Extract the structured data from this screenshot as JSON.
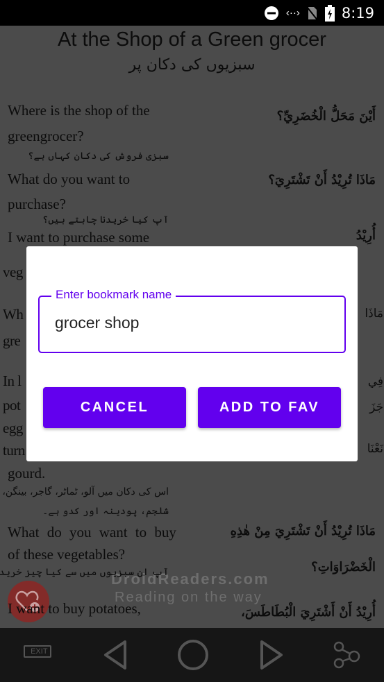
{
  "status_bar": {
    "time": "8:19",
    "icons": [
      "do-not-disturb-icon",
      "data-sync-icon",
      "no-sim-icon",
      "battery-charging-icon"
    ]
  },
  "page": {
    "title": "At the Shop of a Green grocer",
    "urdu_title": "سبزیوں کی دکان پر",
    "english_lines": [
      "Where is the shop of the",
      "greengrocer?",
      "What do you want to",
      "purchase?",
      "I want to purchase some",
      "veg",
      "Wh",
      "gre",
      "In l",
      "pot",
      "egg",
      "turn",
      "gourd.",
      "What do you want to buy",
      "of these vegetables?",
      "I want to buy potatoes,"
    ],
    "urdu_lines": [
      "سبزی فروش کی دکان کہاں ہے؟",
      "آپ کیا خریدنا چاہتے ہیں؟",
      "اس کی دکان میں آلو، ٹماٹر، گاجر، بینگن، بھنڈی،",
      "شلجم، پودینہ اور کدو ہے۔",
      "آپ ان سبزیوں میں سے کیا چیز خریدنا چاہتے ہیں؟"
    ],
    "arabic_lines": [
      "أَيْنَ مَحَلُّ الْخُضَرِيِّ؟",
      "مَاذَا تُرِيْدُ أَنْ تَشْتَرِيَ؟",
      "أُرِيْدُ",
      "مَاذَا",
      "فِي",
      "جَزَ",
      "نَعْنَا",
      "مَاذَا تُرِيْدُ أَنْ تَشْتَرِيَ مِنْ هٰذِهِ",
      "الْخَضْرَاوَاتِ؟",
      "أُرِيْدُ أَنْ أَشْتَرِيَ الْبُطَاطَسَ،"
    ],
    "watermark": [
      "DroidReaders.com",
      "Reading on the way"
    ]
  },
  "fab": {
    "icon": "add-favorite-heart-icon",
    "color": "#e53935"
  },
  "nav_bar": {
    "items": [
      "exit-icon",
      "previous-icon",
      "home-icon",
      "next-icon",
      "share-icon"
    ],
    "exit_label": "EXIT"
  },
  "dialog": {
    "field_label": "Enter bookmark name",
    "field_value": "grocer shop",
    "cancel_label": "CANCEL",
    "add_label": "ADD TO FAV",
    "accent": "#6200ee"
  }
}
